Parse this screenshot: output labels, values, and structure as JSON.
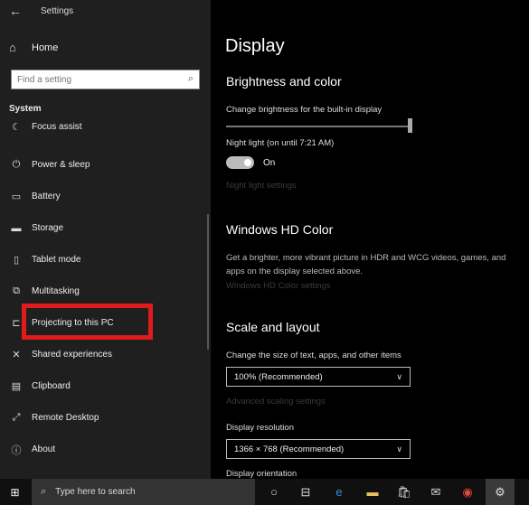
{
  "window": {
    "title": "Settings"
  },
  "sidebar": {
    "home_label": "Home",
    "search_placeholder": "Find a setting",
    "section": "System",
    "items": [
      {
        "label": "Focus assist",
        "icon": "moon-icon"
      },
      {
        "label": "Power & sleep",
        "icon": "power-icon"
      },
      {
        "label": "Battery",
        "icon": "battery-icon"
      },
      {
        "label": "Storage",
        "icon": "storage-icon"
      },
      {
        "label": "Tablet mode",
        "icon": "tablet-icon"
      },
      {
        "label": "Multitasking",
        "icon": "multitasking-icon"
      },
      {
        "label": "Projecting to this PC",
        "icon": "projector-icon"
      },
      {
        "label": "Shared experiences",
        "icon": "shared-icon"
      },
      {
        "label": "Clipboard",
        "icon": "clipboard-icon"
      },
      {
        "label": "Remote Desktop",
        "icon": "remote-desktop-icon"
      },
      {
        "label": "About",
        "icon": "info-icon"
      }
    ]
  },
  "main": {
    "title": "Display",
    "brightness": {
      "heading": "Brightness and color",
      "slider_label": "Change brightness for the built-in display",
      "night_light_label": "Night light (on until 7:21 AM)",
      "toggle_state": "On",
      "night_light_settings": "Night light settings"
    },
    "hd_color": {
      "heading": "Windows HD Color",
      "description": "Get a brighter, more vibrant picture in HDR and WCG videos, games, and apps on the display selected above.",
      "link": "Windows HD Color settings"
    },
    "scale": {
      "heading": "Scale and layout",
      "text_size_label": "Change the size of text, apps, and other items",
      "text_size_value": "100% (Recommended)",
      "advanced_link": "Advanced scaling settings",
      "resolution_label": "Display resolution",
      "resolution_value": "1366 × 768 (Recommended)",
      "orientation_label": "Display orientation"
    }
  },
  "taskbar": {
    "search_placeholder": "Type here to search"
  },
  "colors": {
    "highlight": "#e01b1b",
    "sidebar_bg": "#1f1f1f",
    "content_bg": "#000000"
  }
}
